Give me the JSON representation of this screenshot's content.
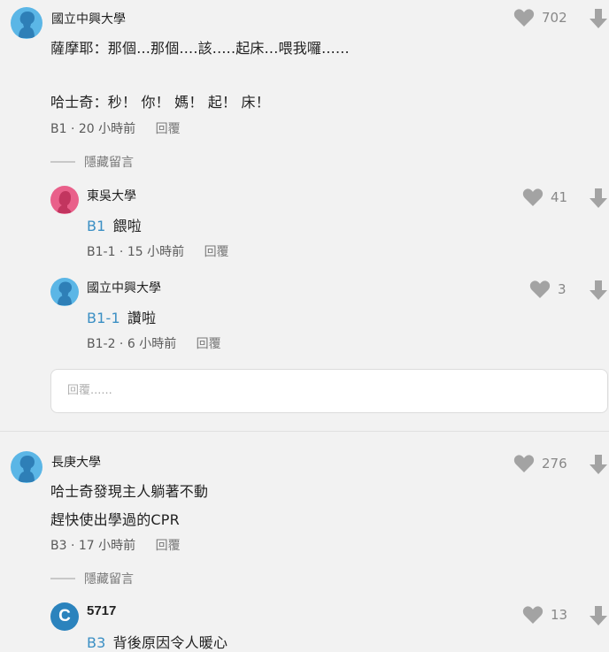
{
  "colors": {
    "background": "#f2f2f2",
    "tag_blue": "#3b8fc4",
    "avatar_blue": "#5bb6e6",
    "avatar_pink": "#e9608a",
    "avatar_c": "#2b83bd",
    "icon_gray": "#a3a3a3"
  },
  "comments": [
    {
      "school": "國立中興大學",
      "lines": [
        "薩摩耶：那個...那個....該.....起床...喂我囉......",
        "哈士奇：秒！ 你！ 媽！ 起！ 床！"
      ],
      "floor": "B1",
      "time": "20 小時前",
      "reply_label": "回覆",
      "likes": "702",
      "hide_label": "隱藏留言",
      "replies": [
        {
          "school": "東吳大學",
          "tag": "B1",
          "text": "餵啦",
          "floor": "B1-1",
          "time": "15 小時前",
          "reply_label": "回覆",
          "likes": "41"
        },
        {
          "school": "國立中興大學",
          "tag": "B1-1",
          "text": "讚啦",
          "floor": "B1-2",
          "time": "6 小時前",
          "reply_label": "回覆",
          "likes": "3"
        }
      ],
      "reply_placeholder": "回覆......"
    },
    {
      "school": "長庚大學",
      "lines": [
        "哈士奇發現主人躺著不動",
        "趕快使出學過的CPR"
      ],
      "floor": "B3",
      "time": "17 小時前",
      "reply_label": "回覆",
      "likes": "276",
      "hide_label": "隱藏留言",
      "replies": [
        {
          "avatar_letter": "C",
          "school": "5717",
          "tag": "B3",
          "text": "背後原因令人暖心",
          "likes": "13"
        }
      ]
    }
  ],
  "icons": {
    "avatar_default": "person-silhouette-icon",
    "like": "heart-icon",
    "dislike": "down-arrow-icon"
  }
}
